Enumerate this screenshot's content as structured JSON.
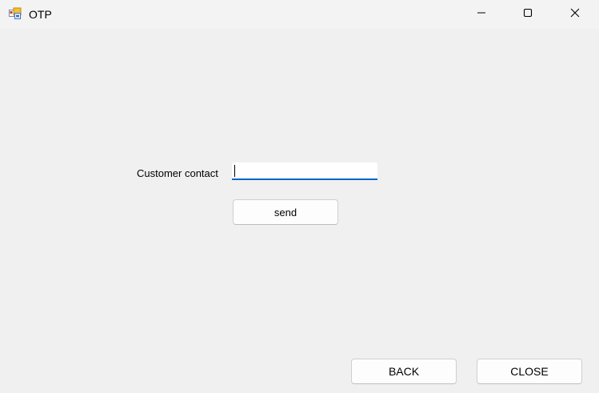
{
  "window": {
    "title": "OTP",
    "icon": "app-form-icon",
    "controls": {
      "minimize": "minimize-icon",
      "maximize": "maximize-icon",
      "close": "close-icon"
    }
  },
  "form": {
    "contact_label": "Customer contact",
    "contact_value": "",
    "send_label": "send"
  },
  "footer": {
    "back_label": "BACK",
    "close_label": "CLOSE"
  },
  "colors": {
    "background": "#f0f0f0",
    "accent": "#0067c0"
  }
}
